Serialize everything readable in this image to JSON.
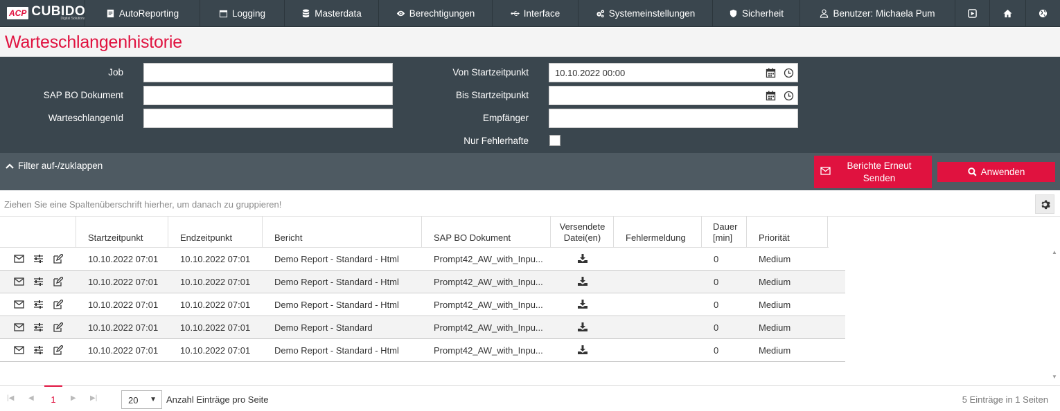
{
  "brand": {
    "logo_acp": "ACP",
    "logo_name": "CUBIDO",
    "logo_sub": "Digital Solutions"
  },
  "nav": {
    "autoreporting": "AutoReporting",
    "logging": "Logging",
    "masterdata": "Masterdata",
    "berechtigungen": "Berechtigungen",
    "interface": "Interface",
    "systemeinstellungen": "Systemeinstellungen",
    "sicherheit": "Sicherheit",
    "user": "Benutzer: Michaela Pum"
  },
  "page": {
    "title": "Warteschlangenhistorie"
  },
  "filter": {
    "job_label": "Job",
    "job_value": "",
    "sapbo_label": "SAP BO Dokument",
    "sapbo_value": "",
    "queueid_label": "WarteschlangenId",
    "queueid_value": "",
    "from_label": "Von Startzeitpunkt",
    "from_value": "10.10.2022 00:00",
    "to_label": "Bis Startzeitpunkt",
    "to_value": "",
    "recipient_label": "Empfänger",
    "recipient_value": "",
    "onlyerrors_label": "Nur Fehlerhafte"
  },
  "toolbar": {
    "toggle_label": "Filter auf-/zuklappen",
    "resend_label": "Berichte Erneut Senden",
    "apply_label": "Anwenden"
  },
  "group_hint": "Ziehen Sie eine Spaltenüberschrift hierher, um danach zu gruppieren!",
  "grid": {
    "columns": {
      "start": "Startzeitpunkt",
      "end": "Endzeitpunkt",
      "report": "Bericht",
      "sapbo": "SAP BO Dokument",
      "files_line1": "Versendete",
      "files_line2": "Datei(en)",
      "error": "Fehlermeldung",
      "duration_line1": "Dauer",
      "duration_line2": "[min]",
      "priority": "Priorität"
    },
    "rows": [
      {
        "start": "10.10.2022 07:01",
        "end": "10.10.2022 07:01",
        "report": "Demo Report - Standard - Html",
        "sapbo": "Prompt42_AW_with_Inpu...",
        "error": "",
        "duration": "0",
        "priority": "Medium"
      },
      {
        "start": "10.10.2022 07:01",
        "end": "10.10.2022 07:01",
        "report": "Demo Report - Standard - Html",
        "sapbo": "Prompt42_AW_with_Inpu...",
        "error": "",
        "duration": "0",
        "priority": "Medium"
      },
      {
        "start": "10.10.2022 07:01",
        "end": "10.10.2022 07:01",
        "report": "Demo Report - Standard - Html",
        "sapbo": "Prompt42_AW_with_Inpu...",
        "error": "",
        "duration": "0",
        "priority": "Medium"
      },
      {
        "start": "10.10.2022 07:01",
        "end": "10.10.2022 07:01",
        "report": "Demo Report - Standard",
        "sapbo": "Prompt42_AW_with_Inpu...",
        "error": "",
        "duration": "0",
        "priority": "Medium"
      },
      {
        "start": "10.10.2022 07:01",
        "end": "10.10.2022 07:01",
        "report": "Demo Report - Standard - Html",
        "sapbo": "Prompt42_AW_with_Inpu...",
        "error": "",
        "duration": "0",
        "priority": "Medium"
      }
    ]
  },
  "pager": {
    "current_page": "1",
    "page_size": "20",
    "page_size_label": "Anzahl Einträge pro Seite",
    "info": "5 Einträge in 1 Seiten"
  },
  "colors": {
    "accent": "#e0123f",
    "nav_bg": "#3a464e",
    "toolbar_bg": "#4e5a62"
  }
}
